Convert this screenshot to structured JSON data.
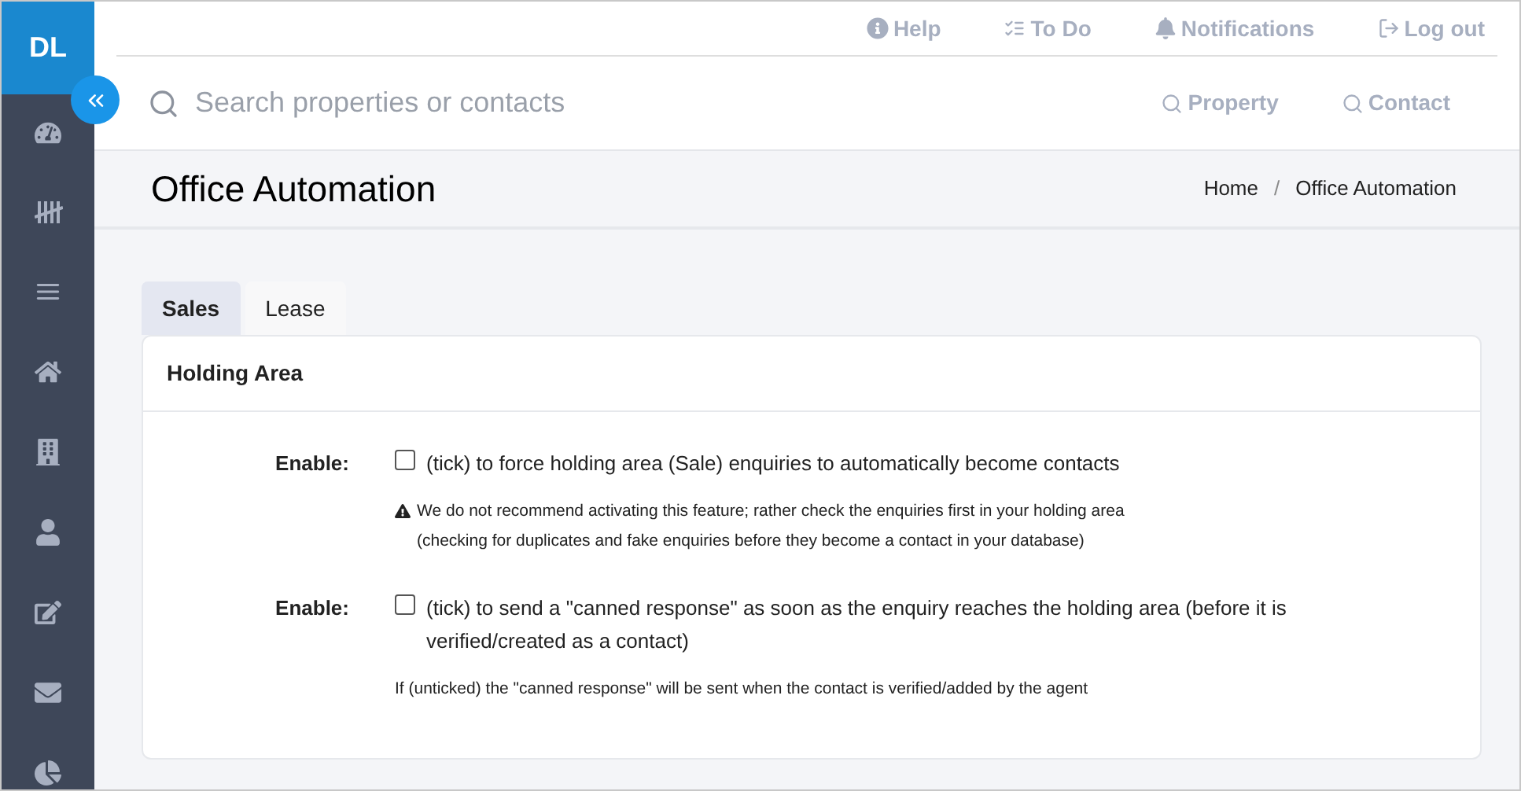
{
  "sidebar": {
    "logo": "DL"
  },
  "top_links": [
    {
      "label": "Help"
    },
    {
      "label": "To Do"
    },
    {
      "label": "Notifications"
    },
    {
      "label": "Log out"
    }
  ],
  "search": {
    "placeholder": "Search properties or contacts"
  },
  "search_buttons": [
    {
      "label": "Property"
    },
    {
      "label": "Contact"
    }
  ],
  "page_title": "Office Automation",
  "breadcrumb": [
    "Home",
    "Office Automation"
  ],
  "breadcrumb_separator": "/",
  "tabs": [
    {
      "label": "Sales",
      "selected": true
    },
    {
      "label": "Lease",
      "selected": false
    }
  ],
  "card": {
    "title": "Holding Area",
    "settings": [
      {
        "label": "Enable:",
        "checked": false,
        "text": "(tick) to force holding area (Sale) enquiries to automatically become contacts",
        "note": "We do not recommend activating this feature; rather check the enquiries first in your holding area\n(checking for duplicates and fake enquiries before they become a contact in your database)",
        "warning": true
      },
      {
        "label": "Enable:",
        "checked": false,
        "text": "(tick) to send a \"canned response\" as soon as the enquiry reaches the holding area (before it is verified/created as a contact)",
        "note": "If (unticked) the \"canned response\" will be sent when the contact is verified/added by the agent",
        "warning": false
      }
    ]
  }
}
